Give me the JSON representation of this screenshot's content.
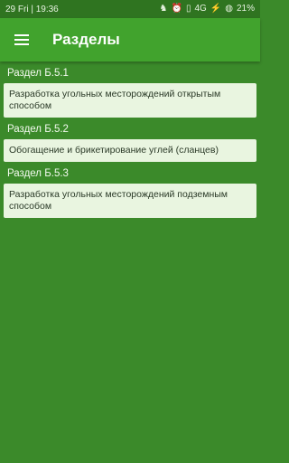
{
  "statusbar": {
    "time": "29 Fri | 19:36",
    "network": "4G",
    "battery": "21%"
  },
  "appbar": {
    "title": "Разделы"
  },
  "sections": [
    {
      "header": "Раздел Б.5.1",
      "text": "Разработка угольных месторождений открытым способом"
    },
    {
      "header": "Раздел Б.5.2",
      "text": "Обогащение и брикетирование углей (сланцев)"
    },
    {
      "header": "Раздел Б.5.3",
      "text": "Разработка угольных месторождений подземным способом"
    }
  ],
  "colors": {
    "background": "#3b8a2a",
    "appbar": "#41a32d",
    "card": "#e9f5e0"
  }
}
